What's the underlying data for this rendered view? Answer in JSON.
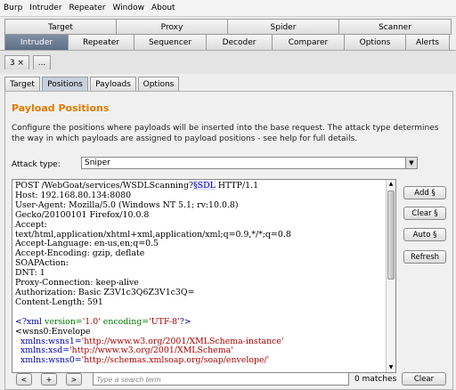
{
  "menu": [
    "Burp",
    "Intruder",
    "Repeater",
    "Window",
    "About"
  ],
  "top_tabs_row1": [
    "Target",
    "Proxy",
    "Spider",
    "Scanner"
  ],
  "top_tabs_row2": [
    "Intruder",
    "Repeater",
    "Sequencer",
    "Decoder",
    "Comparer",
    "Options",
    "Alerts"
  ],
  "instance_tabs": [
    "3 ×",
    "..."
  ],
  "sub_tabs": [
    "Target",
    "Positions",
    "Payloads",
    "Options"
  ],
  "panel": {
    "title": "Payload Positions",
    "description": "Configure the positions where payloads will be inserted into the base request. The attack type determines the way in which payloads are assigned to payload positions - see help for full details.",
    "attack_label": "Attack type:",
    "attack_value": "Sniper"
  },
  "request": {
    "line1_pre": "POST /WebGoat/services/WSDLScanning?",
    "line1_marker": "§SDL",
    "line1_post": " HTTP/1.1",
    "headers": [
      "Host: 192.168.80.134:8080",
      "User-Agent: Mozilla/5.0 (Windows NT 5.1; rv:10.0.8)",
      "Gecko/20100101 Firefox/10.0.8",
      "Accept:",
      "text/html,application/xhtml+xml,application/xml;q=0.9,*/*;q=0.8",
      "Accept-Language: en-us,en;q=0.5",
      "Accept-Encoding: gzip, deflate",
      "SOAPAction:",
      "DNT: 1",
      "Proxy-Connection: keep-alive",
      "Authorization: Basic Z3V1c3Q6Z3V1c3Q=",
      "Content-Length: 591",
      ""
    ],
    "xml_decl_tag": "<?xml ",
    "xml_decl_attr1": "version=",
    "xml_decl_val1": "'1.0'",
    "xml_decl_attr2": " encoding=",
    "xml_decl_val2": "'UTF-8'",
    "xml_decl_end": "?>",
    "envelope": "<wsns0:Envelope",
    "ns1_attr": "  xmlns:wsns1=",
    "ns1_val": "'http://www.w3.org/2001/XMLSchema-instance'",
    "ns2_attr": "  xmlns:xsd=",
    "ns2_val": "'http://www.w3.org/2001/XMLSchema'",
    "ns3_attr": "  xmlns:wsns0=",
    "ns3_val": "'http://schemas.xmlsoap.org/soap/envelope/'"
  },
  "side_buttons": [
    "Add §",
    "Clear §",
    "Auto §",
    "Refresh"
  ],
  "bottom": {
    "prev": "<",
    "add": "+",
    "next": ">",
    "search_placeholder": "Type a search term",
    "matches": "0 matches",
    "clear": "Clear"
  }
}
